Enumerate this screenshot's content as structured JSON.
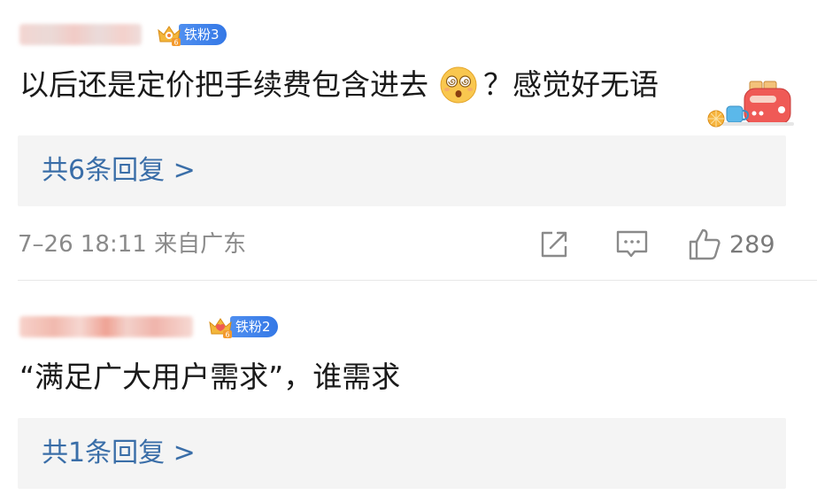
{
  "comments": [
    {
      "fan_badge": "铁粉3",
      "text_before_emoji": "以后还是定价把手续费包含进去",
      "emoji": "dizzy-face-emoji",
      "text_after_emoji": "？感觉好无语",
      "replies_label": "共6条回复 >",
      "timestamp": "7–26 18:11 来自广东",
      "like_count": "289"
    },
    {
      "fan_badge": "铁粉2",
      "text": "“满足广大用户需求”，谁需求",
      "replies_label": "共1条回复 >"
    }
  ],
  "colors": {
    "link": "#3a6ea8",
    "badge": "#3478e6",
    "meta": "#8a8a8a",
    "reply_bg": "#f4f4f4"
  }
}
